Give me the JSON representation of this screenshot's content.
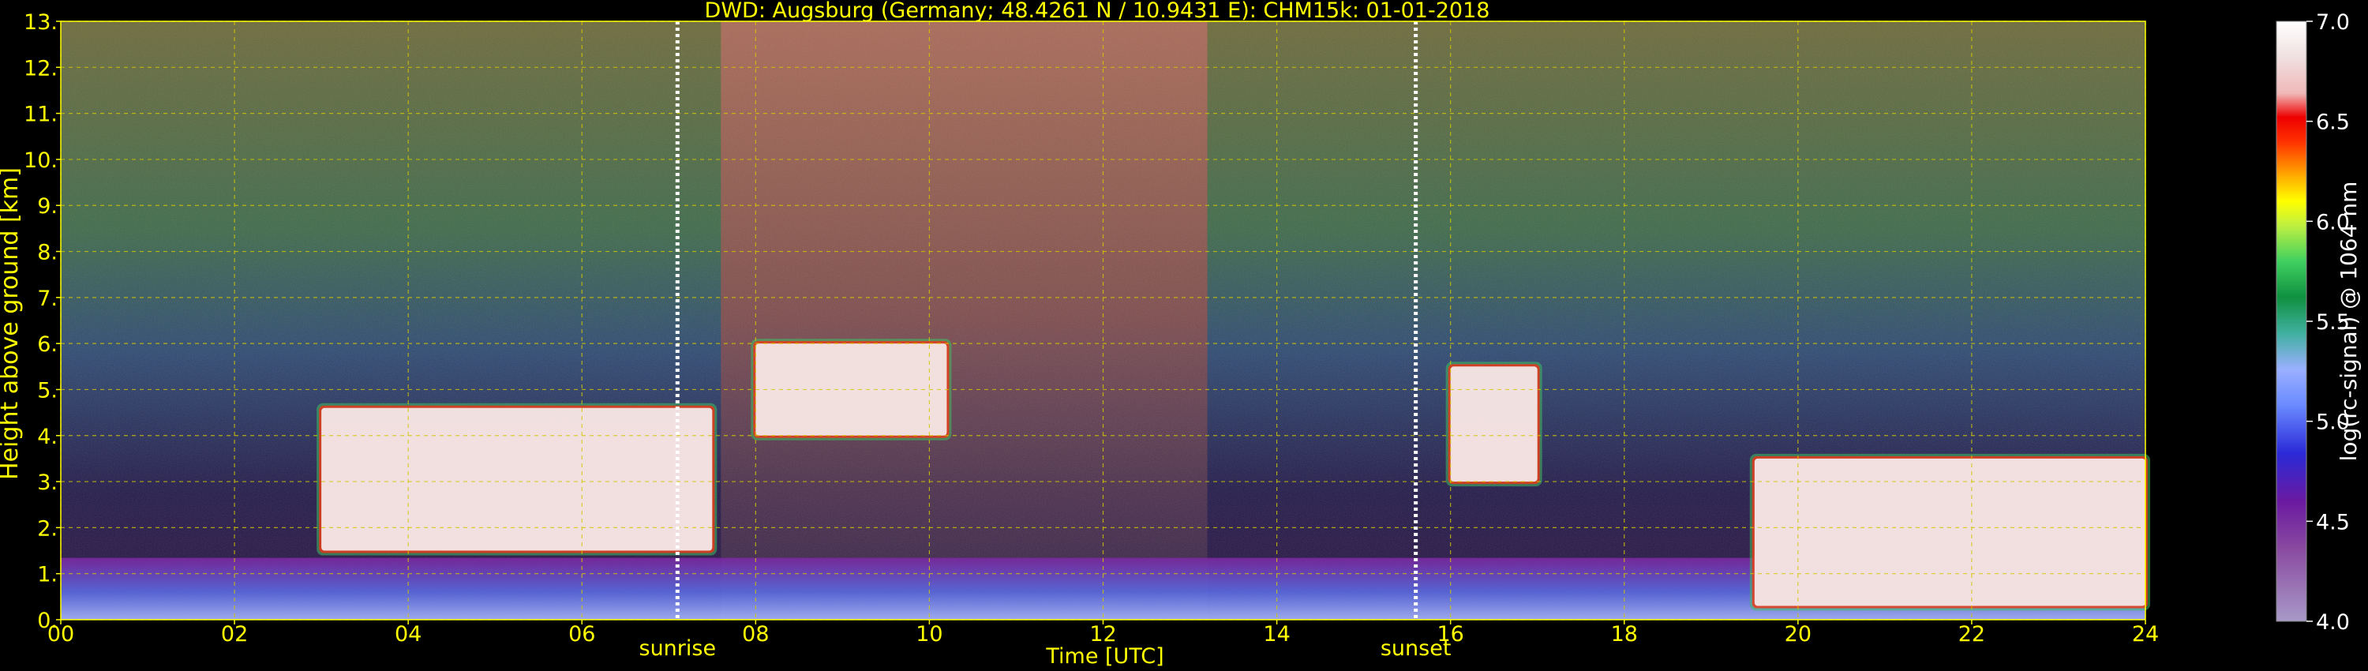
{
  "chart_data": {
    "type": "heatmap",
    "title": "DWD: Augsburg (Germany; 48.4261 N / 10.9431 E):    CHM15k: 01-01-2018",
    "xlabel": "Time [UTC]",
    "ylabel": "Height above ground [km]",
    "xlim": [
      0,
      24
    ],
    "ylim": [
      0,
      13
    ],
    "x_ticks": [
      "00",
      "02",
      "04",
      "06",
      "08",
      "10",
      "12",
      "14",
      "16",
      "18",
      "20",
      "22",
      "24"
    ],
    "y_ticks": [
      "0.",
      "1.",
      "2.",
      "3.",
      "4.",
      "5.",
      "6.",
      "7.",
      "8.",
      "9.",
      "10.",
      "11.",
      "12.",
      "13."
    ],
    "grid": true,
    "markers": [
      {
        "label": "sunrise",
        "time": 7.1
      },
      {
        "label": "sunset",
        "time": 15.6
      }
    ],
    "colorbar": {
      "label": "log(rc-signal) @ 1064 nm",
      "range": [
        4.0,
        7.0
      ],
      "ticks": [
        "4.0",
        "4.5",
        "5.0",
        "5.5",
        "6.0",
        "6.5",
        "7.0"
      ]
    },
    "features": [
      {
        "name": "boundary layer",
        "start": 0,
        "end": 24,
        "height_km": [
          0.0,
          1.0
        ]
      },
      {
        "name": "rising aerosol/cloud layer",
        "start": 3.0,
        "end": 7.5,
        "height_km": [
          1.5,
          4.6
        ]
      },
      {
        "name": "cloud layer",
        "start": 8.0,
        "end": 10.2,
        "height_km": [
          4.0,
          6.0
        ]
      },
      {
        "name": "cloud patch",
        "start": 16.0,
        "end": 17.0,
        "height_km": [
          3.0,
          5.5
        ]
      },
      {
        "name": "low cloud",
        "start": 19.5,
        "end": 24,
        "height_km": [
          0.3,
          3.5
        ]
      }
    ]
  },
  "colors": {
    "background": "#000000",
    "text": "#ffff00",
    "grid": "#d4c800",
    "marker": "#ffffff"
  }
}
